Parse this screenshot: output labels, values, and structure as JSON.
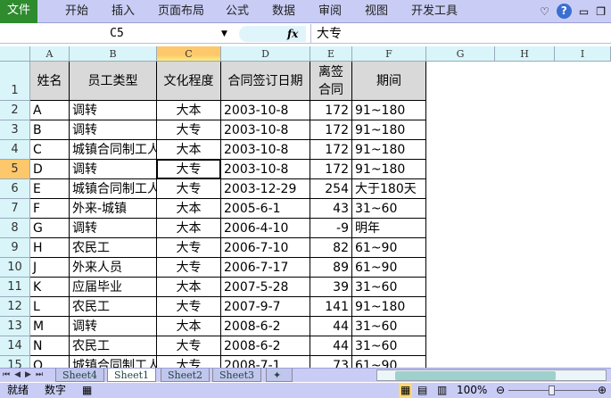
{
  "ribbon": {
    "file": "文件",
    "tabs": [
      "开始",
      "插入",
      "页面布局",
      "公式",
      "数据",
      "审阅",
      "视图",
      "开发工具"
    ]
  },
  "formula_bar": {
    "name_box": "C5",
    "fx": "fx",
    "value": "大专"
  },
  "columns": [
    "A",
    "B",
    "C",
    "D",
    "E",
    "F",
    "G",
    "H",
    "I"
  ],
  "header_row": [
    "姓名",
    "员工类型",
    "文化程度",
    "合同签订日期",
    "离签\n合同",
    "期间"
  ],
  "rows": [
    [
      "A",
      "调转",
      "大本",
      "2003-10-8",
      "172",
      "91~180"
    ],
    [
      "B",
      "调转",
      "大专",
      "2003-10-8",
      "172",
      "91~180"
    ],
    [
      "C",
      "城镇合同制工人",
      "大本",
      "2003-10-8",
      "172",
      "91~180"
    ],
    [
      "D",
      "调转",
      "大专",
      "2003-10-8",
      "172",
      "91~180"
    ],
    [
      "E",
      "城镇合同制工人",
      "大专",
      "2003-12-29",
      "254",
      "大于180天"
    ],
    [
      "F",
      "外来-城镇",
      "大本",
      "2005-6-1",
      "43",
      "31~60"
    ],
    [
      "G",
      "调转",
      "大本",
      "2006-4-10",
      "-9",
      "明年"
    ],
    [
      "H",
      "农民工",
      "大专",
      "2006-7-10",
      "82",
      "61~90"
    ],
    [
      "J",
      "外来人员",
      "大专",
      "2006-7-17",
      "89",
      "61~90"
    ],
    [
      "K",
      "应届毕业",
      "大本",
      "2007-5-28",
      "39",
      "31~60"
    ],
    [
      "L",
      "农民工",
      "大专",
      "2007-9-7",
      "141",
      "91~180"
    ],
    [
      "M",
      "调转",
      "大本",
      "2008-6-2",
      "44",
      "31~60"
    ],
    [
      "N",
      "农民工",
      "大专",
      "2008-6-2",
      "44",
      "31~60"
    ],
    [
      "O",
      "城镇合同制工人",
      "大专",
      "2008-7-1",
      "73",
      "61~90"
    ]
  ],
  "sheets": [
    "Sheet4",
    "Sheet1",
    "Sheet2",
    "Sheet3"
  ],
  "active_sheet": "Sheet1",
  "status": {
    "ready": "就绪",
    "mode": "数字",
    "zoom": "100%"
  }
}
